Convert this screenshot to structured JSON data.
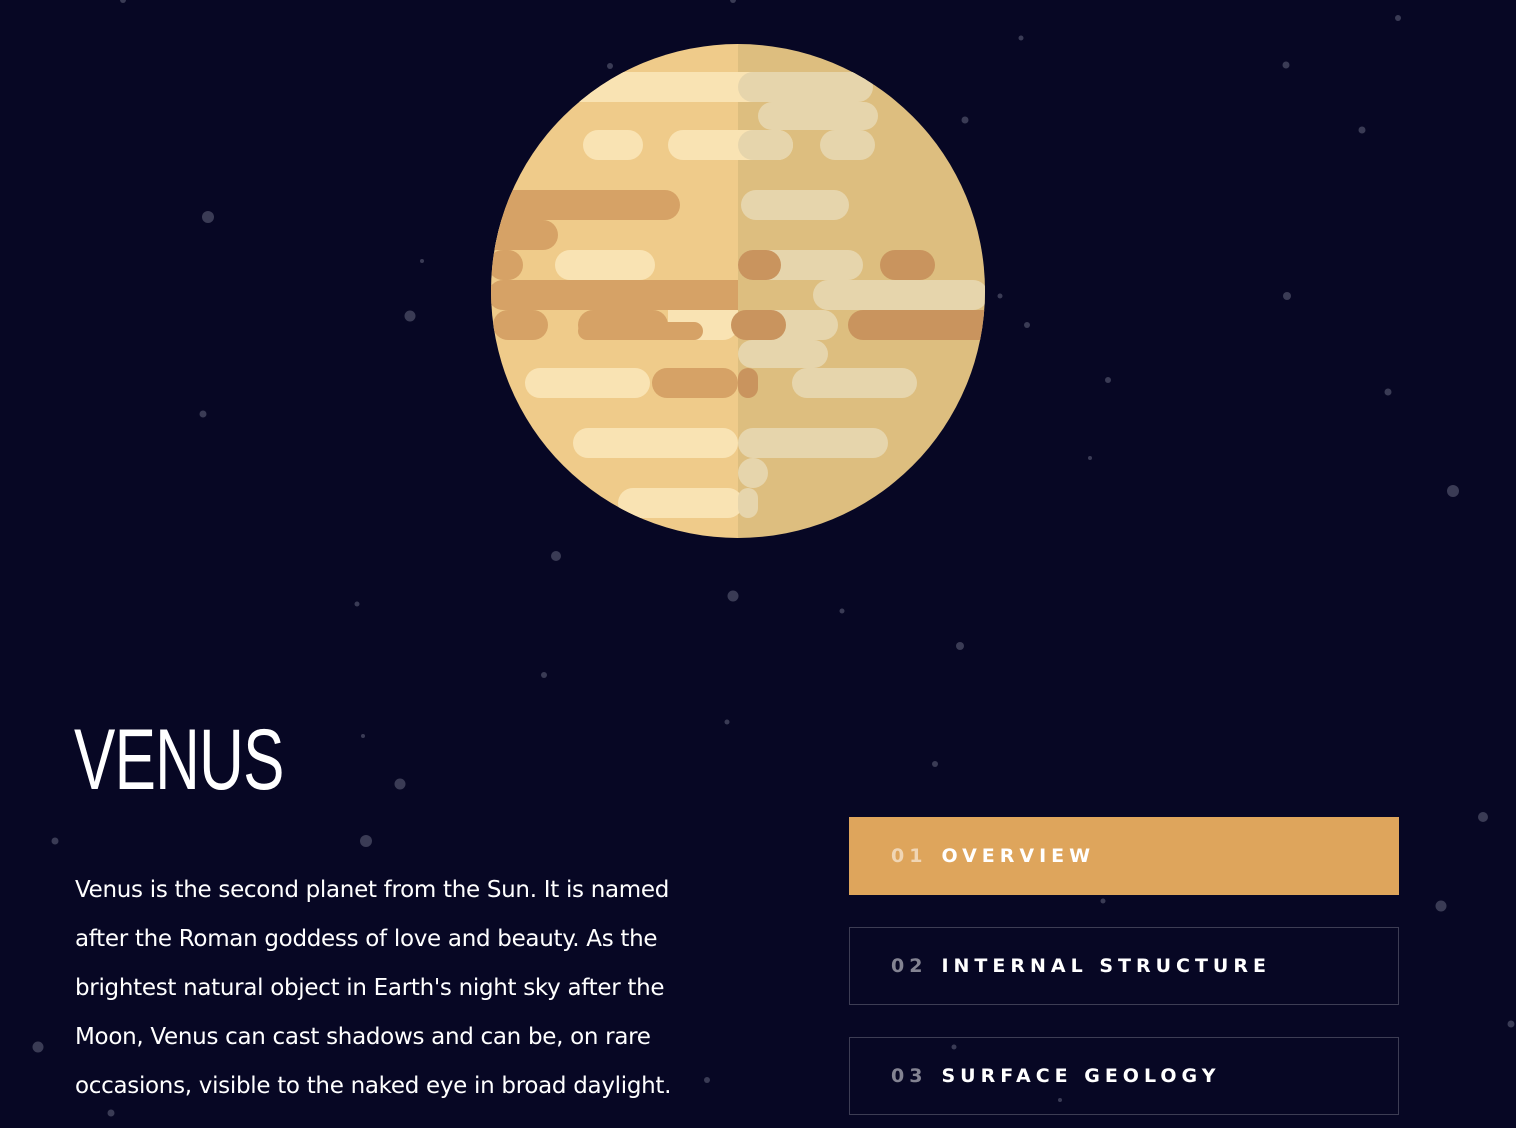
{
  "planet": {
    "name": "VENUS",
    "description": "Venus is the second planet from the Sun. It is named after the Roman goddess of love and beauty. As the brightest natural object in Earth's night sky after the Moon, Venus can cast shadows and can be, on rare occasions, visible to the naked eye in broad daylight."
  },
  "tabs": [
    {
      "number": "01",
      "label": "OVERVIEW",
      "active": true
    },
    {
      "number": "02",
      "label": "INTERNAL STRUCTURE",
      "active": false
    },
    {
      "number": "03",
      "label": "SURFACE GEOLOGY",
      "active": false
    }
  ],
  "colors": {
    "background": "#070724",
    "accent": "#DEA55C",
    "planet_base": "#EFCB8A",
    "planet_shadow": "#DDBE7F"
  },
  "icons": {
    "planet_illustration": "venus-planet-icon"
  }
}
